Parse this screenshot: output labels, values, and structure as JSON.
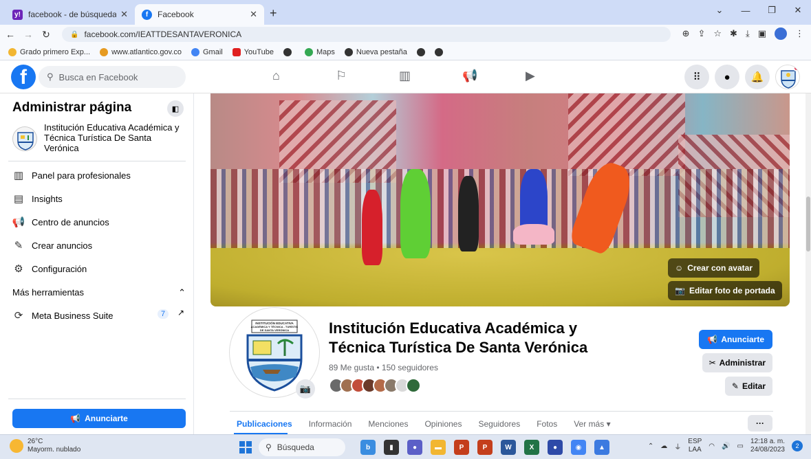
{
  "browser": {
    "tabs": [
      {
        "title": "facebook - de búsqueda",
        "active": false
      },
      {
        "title": "Facebook",
        "active": true
      }
    ],
    "new_tab": "+",
    "url": "facebook.com/IEATTDESANTAVERONICA",
    "bookmarks": [
      {
        "label": "Grado primero Exp..."
      },
      {
        "label": "www.atlantico.gov.co"
      },
      {
        "label": "Gmail"
      },
      {
        "label": "YouTube"
      },
      {
        "label": ""
      },
      {
        "label": "Maps"
      },
      {
        "label": "Nueva pestaña"
      }
    ]
  },
  "fb": {
    "search_placeholder": "Busca en Facebook"
  },
  "sidebar": {
    "title": "Administrar página",
    "page_name": "Institución Educativa Académica y Técnica Turística De Santa Verónica",
    "items": [
      {
        "label": "Panel para profesionales",
        "icon": "dashboard-icon"
      },
      {
        "label": "Insights",
        "icon": "insights-icon"
      },
      {
        "label": "Centro de anuncios",
        "icon": "megaphone-icon"
      },
      {
        "label": "Crear anuncios",
        "icon": "pencil-icon"
      },
      {
        "label": "Configuración",
        "icon": "gear-icon"
      }
    ],
    "more_tools": "Más herramientas",
    "meta_suite": "Meta Business Suite",
    "meta_badge": "7",
    "ad_button": "Anunciarte"
  },
  "cover": {
    "avatar_button": "Crear con avatar",
    "edit_cover_button": "Editar foto de portada"
  },
  "page": {
    "name": "Institución Educativa Académica y Técnica Turística De Santa Verónica",
    "stats": "89 Me gusta • 150 seguidores",
    "logo_text": "INSTITUCIÓN EDUCATIVA ACADÉMICA Y TÉCNICA - TURÍSTIC DE SANTA VERÓNICA",
    "btn_advertise": "Anunciarte",
    "btn_manage": "Administrar",
    "btn_edit": "Editar",
    "tabs": [
      "Publicaciones",
      "Información",
      "Menciones",
      "Opiniones",
      "Seguidores",
      "Fotos",
      "Ver más ▾"
    ],
    "more": "···"
  },
  "taskbar": {
    "temp": "26°C",
    "weather": "Mayorm. nublado",
    "search": "Búsqueda",
    "lang1": "ESP",
    "lang2": "LAA",
    "time": "12:18 a. m.",
    "date": "24/08/2023",
    "notif_count": "2"
  }
}
